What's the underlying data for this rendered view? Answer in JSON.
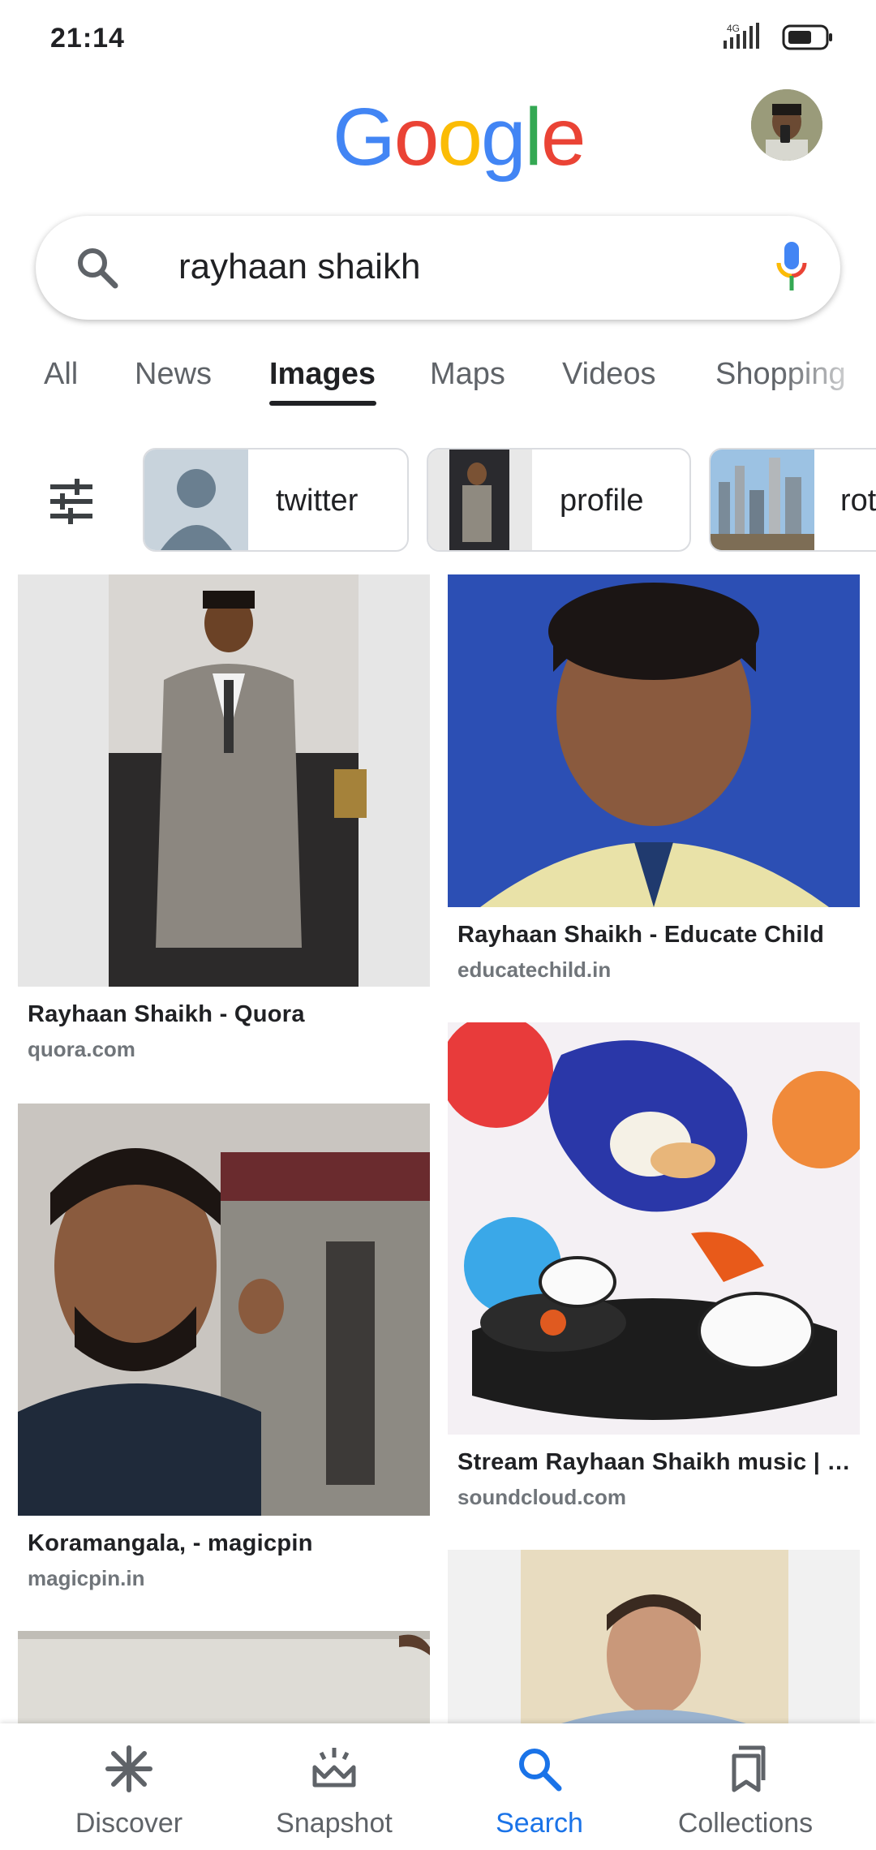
{
  "status_bar": {
    "time": "21:14",
    "network": "4G",
    "icons": [
      "signal-icon",
      "battery-icon"
    ]
  },
  "header": {
    "logo_letters": [
      {
        "ch": "G",
        "color": "#4285F4"
      },
      {
        "ch": "o",
        "color": "#EA4335"
      },
      {
        "ch": "o",
        "color": "#FBBC05"
      },
      {
        "ch": "g",
        "color": "#4285F4"
      },
      {
        "ch": "l",
        "color": "#34A853"
      },
      {
        "ch": "e",
        "color": "#EA4335"
      }
    ],
    "avatar": "account-avatar"
  },
  "search": {
    "query": "rayhaan shaikh",
    "icons": [
      "search-icon",
      "mic-icon"
    ]
  },
  "tabs": [
    {
      "label": "All",
      "active": false
    },
    {
      "label": "News",
      "active": false
    },
    {
      "label": "Images",
      "active": true
    },
    {
      "label": "Maps",
      "active": false
    },
    {
      "label": "Videos",
      "active": false
    },
    {
      "label": "Shopping",
      "active": false
    }
  ],
  "chips": [
    {
      "label": "twitter"
    },
    {
      "label": "profile"
    },
    {
      "label": "rot"
    }
  ],
  "results": [
    {
      "title": "Rayhaan Shaikh - Quora",
      "source": "quora.com"
    },
    {
      "title": "Rayhaan Shaikh - Educate Child",
      "source": "educatechild.in"
    },
    {
      "title": "Koramangala, - magicpin",
      "source": "magicpin.in"
    },
    {
      "title": "Stream Rayhaan Shaikh music | …",
      "source": "soundcloud.com"
    }
  ],
  "bottom_nav": [
    {
      "label": "Discover",
      "icon": "asterisk-icon",
      "active": false
    },
    {
      "label": "Snapshot",
      "icon": "snapshot-icon",
      "active": false
    },
    {
      "label": "Search",
      "icon": "search-icon",
      "active": true
    },
    {
      "label": "Collections",
      "icon": "bookmarks-icon",
      "active": false
    }
  ],
  "colors": {
    "accent": "#1a73e8",
    "text": "#202124",
    "muted": "#5f6368"
  }
}
